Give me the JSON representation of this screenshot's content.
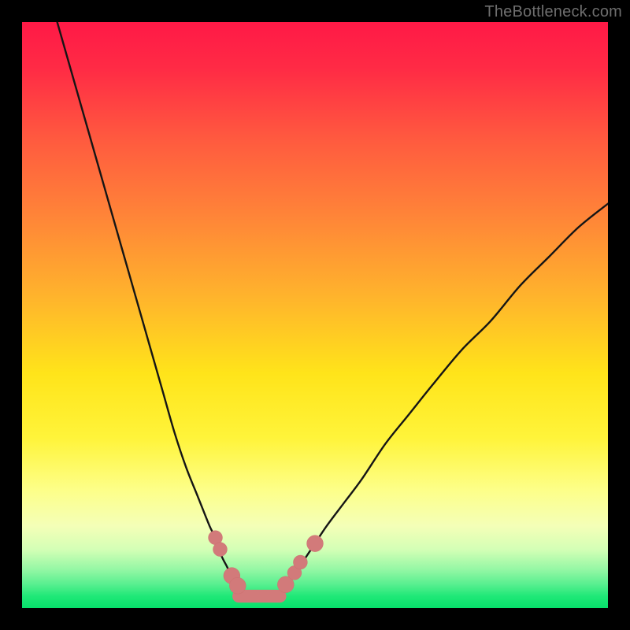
{
  "watermark": "TheBottleneck.com",
  "colors": {
    "background": "#000000",
    "curve_stroke": "#151515",
    "marker_fill": "#d27a7a",
    "marker_stroke": "#cc6f6f"
  },
  "chart_data": {
    "type": "line",
    "title": "",
    "xlabel": "",
    "ylabel": "",
    "xlim": [
      0,
      100
    ],
    "ylim": [
      0,
      100
    ],
    "grid": false,
    "note": "Axes have no labels or ticks in the image; values are normalized 0-100 estimates from pixel position. Left branch is a steep descent, right branch is a gentler rise; they meet in a flat trough near x≈37-44, y≈2.",
    "series": [
      {
        "name": "left_branch",
        "x": [
          6,
          8,
          10,
          12,
          14,
          16,
          18,
          20,
          22,
          24,
          26,
          28,
          30,
          32,
          33,
          34,
          35,
          36,
          37
        ],
        "y": [
          100,
          93,
          86,
          79,
          72,
          65,
          58,
          51,
          44,
          37,
          30,
          24,
          19,
          14,
          12,
          9,
          7,
          5,
          3
        ]
      },
      {
        "name": "trough",
        "x": [
          37,
          38,
          39,
          40,
          41,
          42,
          43,
          44
        ],
        "y": [
          3,
          2,
          2,
          2,
          2,
          2,
          2,
          3
        ]
      },
      {
        "name": "right_branch",
        "x": [
          44,
          46,
          48,
          50,
          52,
          55,
          58,
          62,
          66,
          70,
          75,
          80,
          85,
          90,
          95,
          100
        ],
        "y": [
          3,
          5,
          8,
          11,
          14,
          18,
          22,
          28,
          33,
          38,
          44,
          49,
          55,
          60,
          65,
          69
        ]
      }
    ],
    "markers": {
      "name": "highlighted_points",
      "comment": "Salmon/pink circular markers near the trough on both branches plus a thick horizontal marker bar across the flat bottom.",
      "points": [
        {
          "x": 33.0,
          "y": 12.0,
          "r": 1.2
        },
        {
          "x": 33.8,
          "y": 10.0,
          "r": 1.2
        },
        {
          "x": 35.8,
          "y": 5.5,
          "r": 1.4
        },
        {
          "x": 36.8,
          "y": 3.8,
          "r": 1.4
        },
        {
          "x": 45.0,
          "y": 4.0,
          "r": 1.4
        },
        {
          "x": 46.5,
          "y": 6.0,
          "r": 1.2
        },
        {
          "x": 47.5,
          "y": 7.8,
          "r": 1.2
        },
        {
          "x": 50.0,
          "y": 11.0,
          "r": 1.4
        }
      ],
      "bar": {
        "x0": 37.0,
        "x1": 44.0,
        "y": 2.0,
        "thickness": 2.2
      }
    }
  }
}
